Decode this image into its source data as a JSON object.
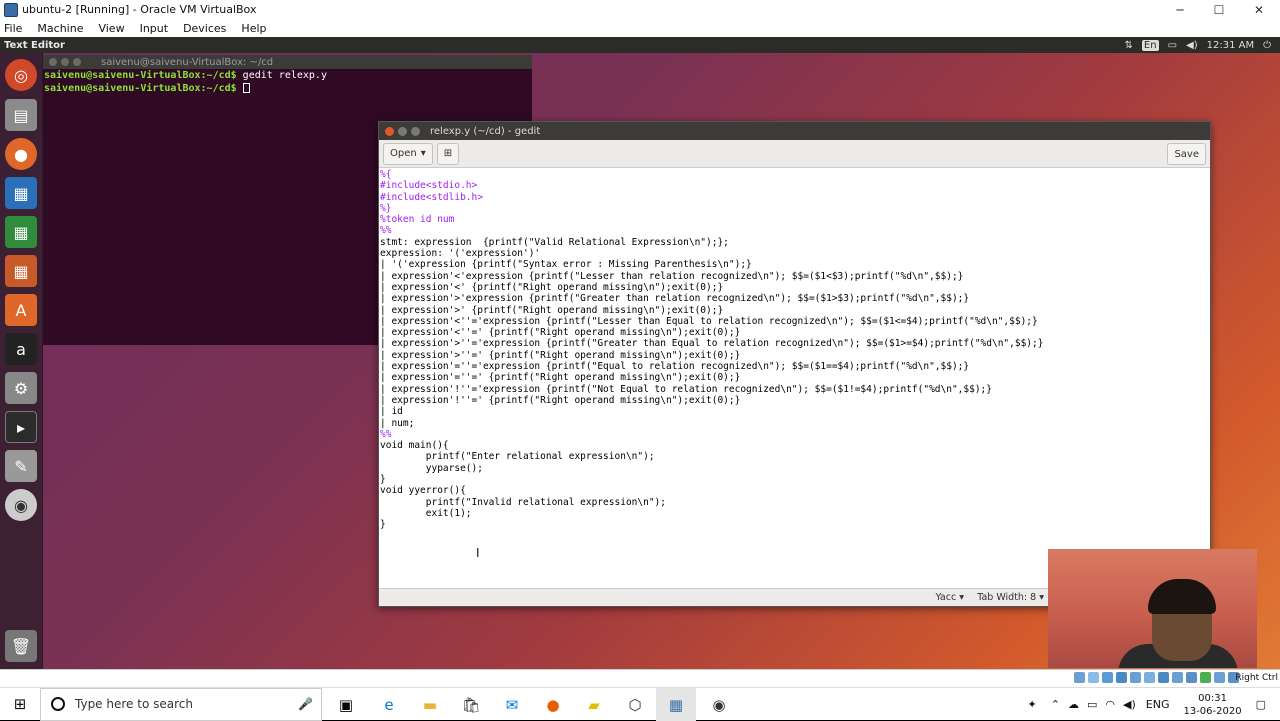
{
  "window": {
    "title": "ubuntu-2 [Running] - Oracle VM VirtualBox",
    "min": "─",
    "max": "☐",
    "close": "✕"
  },
  "menu": [
    "File",
    "Machine",
    "View",
    "Input",
    "Devices",
    "Help"
  ],
  "panel": {
    "app_name": "Text Editor",
    "indicators": [
      "⇅",
      "En",
      "▭",
      "◀)",
      "12:31 AM",
      "⏻"
    ]
  },
  "terminal": {
    "title": "saivenu@saivenu-VirtualBox: ~/cd",
    "lines": [
      {
        "prompt": "saivenu@saivenu-VirtualBox:~/cd$",
        "cmd": " gedit relexp.y"
      },
      {
        "prompt": "saivenu@saivenu-VirtualBox:~/cd$",
        "cmd": " "
      }
    ]
  },
  "gedit": {
    "title": "relexp.y (~/cd) - gedit",
    "open_label": "Open",
    "save_label": "Save",
    "language": "Yacc",
    "tab_width": "Tab Width: 8",
    "code": [
      "%{",
      "#include<stdio.h>",
      "#include<stdlib.h>",
      "%}",
      "%token id num",
      "%%",
      "stmt: expression  {printf(\"Valid Relational Expression\\n\");};",
      "expression: '('expression')'",
      "| '('expression {printf(\"Syntax error : Missing Parenthesis\\n\");}",
      "| expression'<'expression {printf(\"Lesser than relation recognized\\n\"); $$=($1<$3);printf(\"%d\\n\",$$);}",
      "| expression'<' {printf(\"Right operand missing\\n\");exit(0);}",
      "| expression'>'expression {printf(\"Greater than relation recognized\\n\"); $$=($1>$3);printf(\"%d\\n\",$$);}",
      "| expression'>' {printf(\"Right operand missing\\n\");exit(0);}",
      "| expression'<''='expression {printf(\"Lesser than Equal to relation recognized\\n\"); $$=($1<=$4);printf(\"%d\\n\",$$);}",
      "| expression'<''=' {printf(\"Right operand missing\\n\");exit(0);}",
      "| expression'>''='expression {printf(\"Greater than Equal to relation recognized\\n\"); $$=($1>=$4);printf(\"%d\\n\",$$);}",
      "| expression'>''=' {printf(\"Right operand missing\\n\");exit(0);}",
      "| expression'=''='expression {printf(\"Equal to relation recognized\\n\"); $$=($1==$4);printf(\"%d\\n\",$$);}",
      "| expression'=''=' {printf(\"Right operand missing\\n\");exit(0);}",
      "| expression'!''='expression {printf(\"Not Equal to relation recognized\\n\"); $$=($1!=$4);printf(\"%d\\n\",$$);}",
      "| expression'!''=' {printf(\"Right operand missing\\n\");exit(0);}",
      "| id",
      "| num;",
      "%%",
      "void main(){",
      "        printf(\"Enter relational expression\\n\");",
      "        yyparse();",
      "}",
      "void yyerror(){",
      "        printf(\"Invalid relational expression\\n\");",
      "        exit(1);",
      "}"
    ]
  },
  "vbox_status": {
    "host_key": "Right Ctrl"
  },
  "taskbar": {
    "search_placeholder": "Type here to search",
    "time": "00:31",
    "date": "13-06-2020",
    "lang": "ENG"
  }
}
